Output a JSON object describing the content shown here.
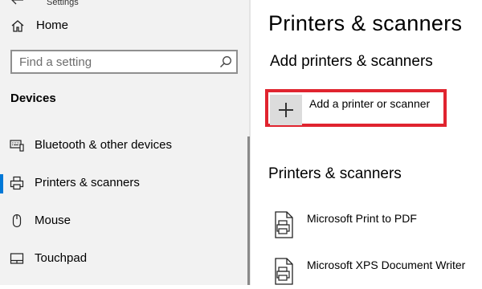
{
  "window": {
    "title": "Settings"
  },
  "sidebar": {
    "home_label": "Home",
    "search_placeholder": "Find a setting",
    "section_heading": "Devices",
    "items": [
      {
        "label": "Bluetooth & other devices",
        "icon": "bluetooth-devices-icon",
        "selected": false
      },
      {
        "label": "Printers & scanners",
        "icon": "printer-icon",
        "selected": true
      },
      {
        "label": "Mouse",
        "icon": "mouse-icon",
        "selected": false
      },
      {
        "label": "Touchpad",
        "icon": "touchpad-icon",
        "selected": false
      }
    ]
  },
  "main": {
    "title": "Printers & scanners",
    "add_heading": "Add printers & scanners",
    "add_button_label": "Add a printer or scanner",
    "list_heading": "Printers & scanners",
    "printers": [
      {
        "name": "Microsoft Print to PDF",
        "icon": "printer-document-icon"
      },
      {
        "name": "Microsoft XPS Document Writer",
        "icon": "printer-document-icon"
      }
    ]
  },
  "colors": {
    "accent": "#0078d7",
    "highlight_border": "#e0242f",
    "sidebar_bg": "#f2f2f2"
  }
}
